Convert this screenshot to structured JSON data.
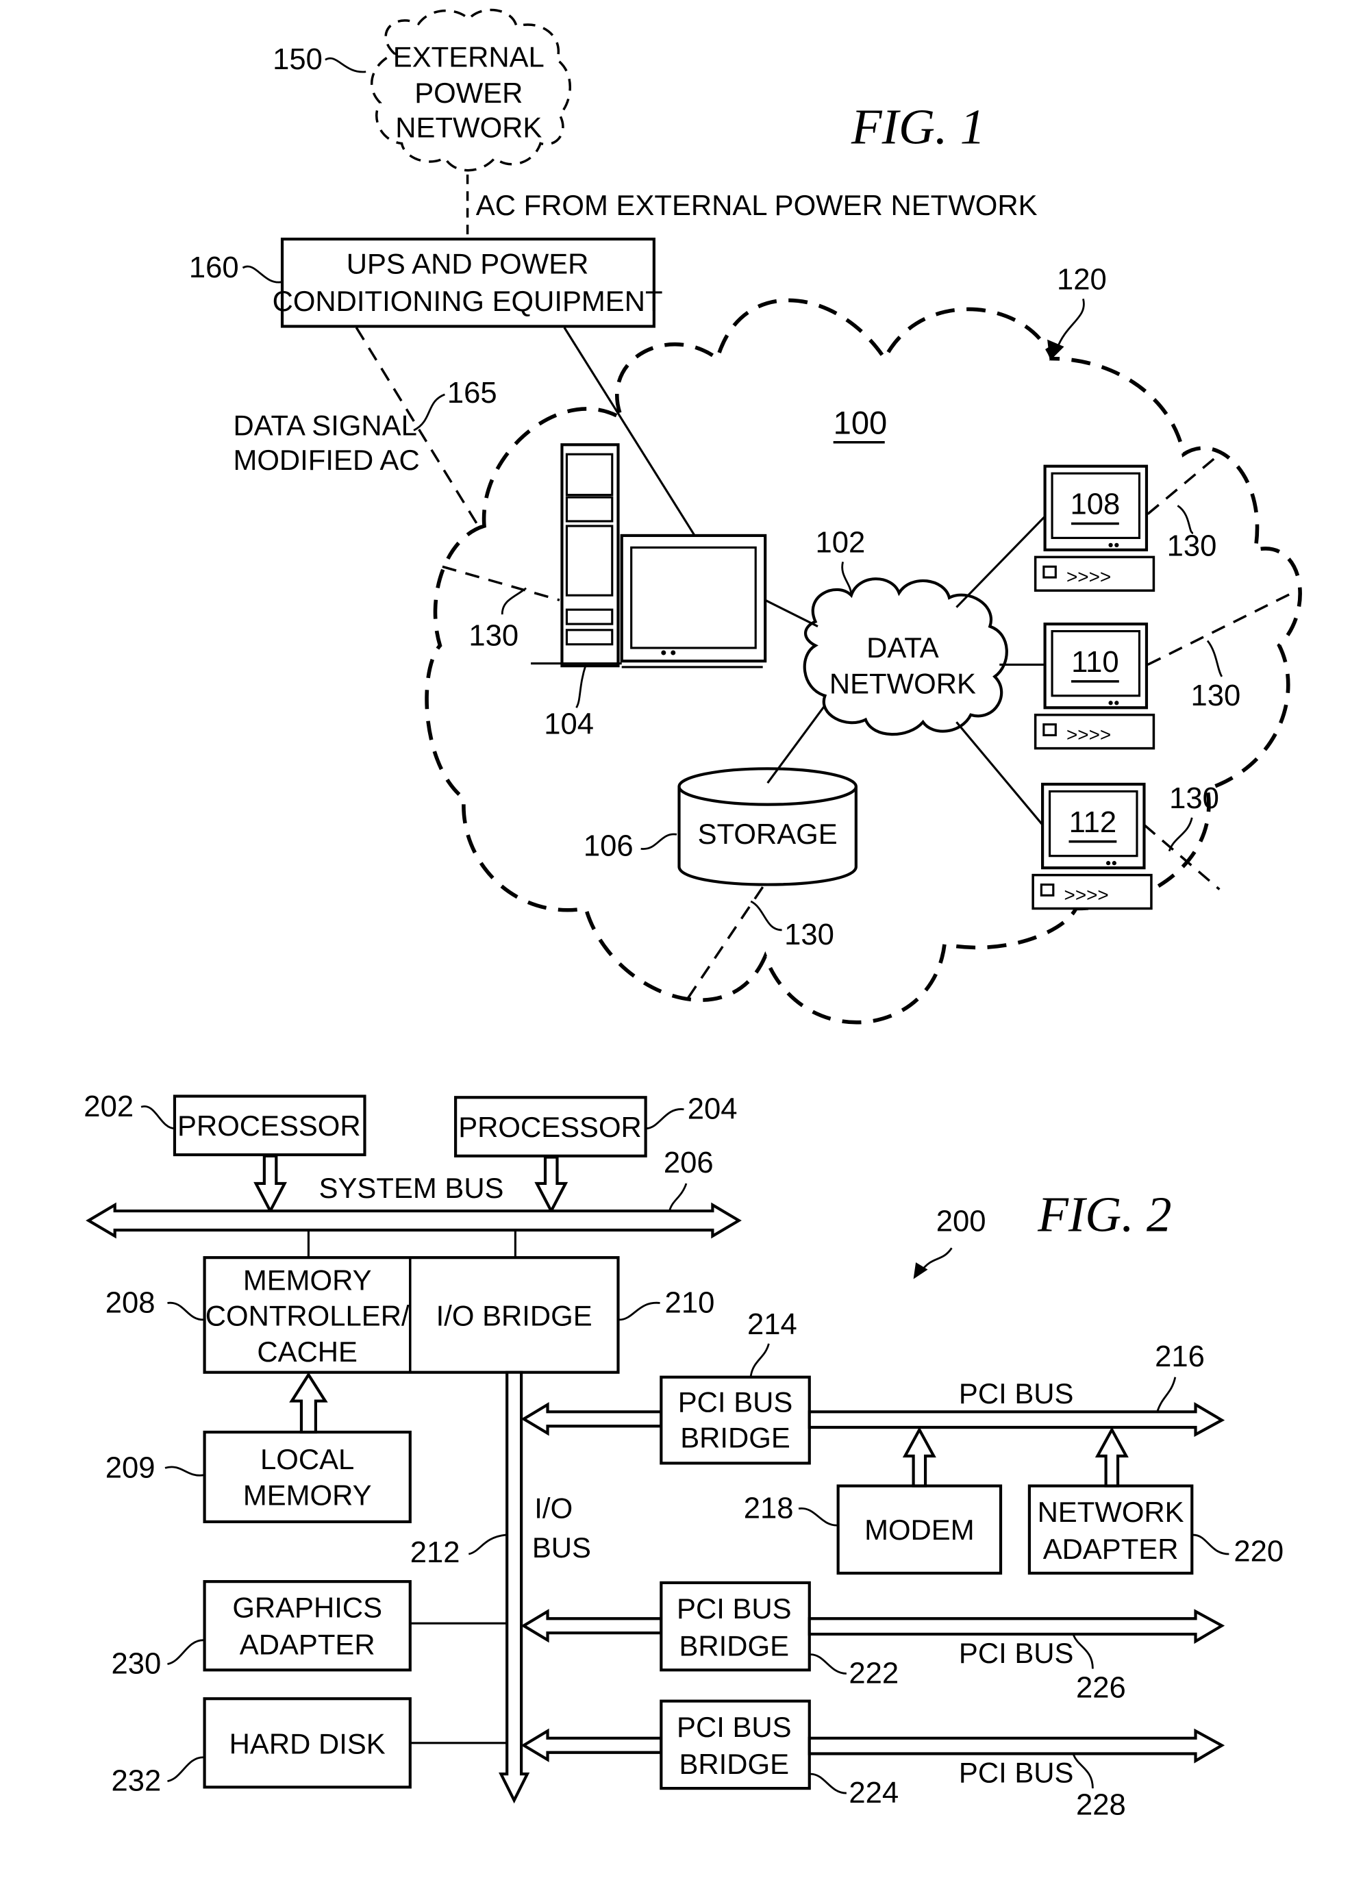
{
  "fig1": {
    "title": "FIG. 1",
    "external_power": {
      "ref": "150",
      "lines": [
        "EXTERNAL",
        "POWER",
        "NETWORK"
      ]
    },
    "ac_label": "AC FROM EXTERNAL POWER NETWORK",
    "ups": {
      "ref": "160",
      "lines": [
        "UPS AND POWER",
        "CONDITIONING EQUIPMENT"
      ]
    },
    "data_signal": {
      "ref": "165",
      "lines": [
        "DATA SIGNAL",
        "MODIFIED AC"
      ]
    },
    "cloud_ref": "120",
    "network_ref": "100",
    "data_network": {
      "ref": "102",
      "lines": [
        "DATA",
        "NETWORK"
      ]
    },
    "server_ref": "104",
    "storage": {
      "ref": "106",
      "label": "STORAGE"
    },
    "clients": [
      {
        "ref": "108"
      },
      {
        "ref": "110"
      },
      {
        "ref": "112"
      }
    ],
    "powerline_ref": "130"
  },
  "fig2": {
    "title": "FIG. 2",
    "system_ref": "200",
    "processor_a": {
      "ref": "202",
      "label": "PROCESSOR"
    },
    "processor_b": {
      "ref": "204",
      "label": "PROCESSOR"
    },
    "system_bus": {
      "ref": "206",
      "label": "SYSTEM BUS"
    },
    "mem_ctrl": {
      "ref": "208",
      "lines": [
        "MEMORY",
        "CONTROLLER/",
        "CACHE"
      ]
    },
    "local_memory": {
      "ref": "209",
      "lines": [
        "LOCAL",
        "MEMORY"
      ]
    },
    "io_bridge": {
      "ref": "210",
      "label": "I/O BRIDGE"
    },
    "io_bus": {
      "ref": "212",
      "lines": [
        "I/O",
        "BUS"
      ]
    },
    "pci_bridge_1": {
      "ref": "214",
      "lines": [
        "PCI BUS",
        "BRIDGE"
      ]
    },
    "pci_bus_1": {
      "ref": "216",
      "label": "PCI BUS"
    },
    "modem": {
      "ref": "218",
      "label": "MODEM"
    },
    "network_adapter": {
      "ref": "220",
      "lines": [
        "NETWORK",
        "ADAPTER"
      ]
    },
    "pci_bridge_2": {
      "ref": "222",
      "lines": [
        "PCI BUS",
        "BRIDGE"
      ]
    },
    "pci_bus_2": {
      "ref": "226",
      "label": "PCI BUS"
    },
    "pci_bridge_3": {
      "ref": "224",
      "lines": [
        "PCI BUS",
        "BRIDGE"
      ]
    },
    "pci_bus_3": {
      "ref": "228",
      "label": "PCI BUS"
    },
    "graphics": {
      "ref": "230",
      "lines": [
        "GRAPHICS",
        "ADAPTER"
      ]
    },
    "hard_disk": {
      "ref": "232",
      "label": "HARD DISK"
    }
  }
}
